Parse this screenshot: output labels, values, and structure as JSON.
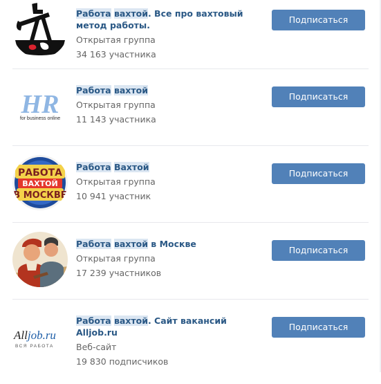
{
  "groups": [
    {
      "title_hl1": "Работа",
      "title_sp1": " ",
      "title_hl2": "вахтой",
      "title_rest": ". Все про вахтовый метод работы.",
      "type": "Открытая группа",
      "members": "34 163 участника",
      "button": "Подписаться",
      "avatar_icon": "oil-pump-icon"
    },
    {
      "title_hl1": "Работа",
      "title_sp1": " ",
      "title_hl2": "вахтой",
      "title_rest": "",
      "type": "Открытая группа",
      "members": "11 143 участника",
      "button": "Подписаться",
      "avatar_icon": "hr-logo-icon",
      "logo_main": "HR",
      "logo_sub": "for business online"
    },
    {
      "title_hl1": "Работа",
      "title_sp1": " ",
      "title_hl2": "Вахтой",
      "title_rest": "",
      "type": "Открытая группа",
      "members": "10 941 участник",
      "button": "Подписаться",
      "avatar_icon": "badge-logo-icon",
      "logo_line1": "РАБОТА",
      "logo_line2": "ВАХТОЙ",
      "logo_line3": "В МОСКВЕ"
    },
    {
      "title_hl1": "Работа",
      "title_sp1": " ",
      "title_hl2": "вахтой",
      "title_rest": " в Москве",
      "type": "Открытая группа",
      "members": "17 239 участников",
      "button": "Подписаться",
      "avatar_icon": "workers-poster-icon"
    },
    {
      "title_hl1": "Работа",
      "title_sp1": " ",
      "title_hl2": "вахтой",
      "title_rest": ". Сайт вакансий Alljob.ru",
      "type": "Веб-сайт",
      "members": "19 830 подписчиков",
      "button": "Подписаться",
      "avatar_icon": "alljob-logo-icon",
      "logo_a": "All",
      "logo_b": "job.ru",
      "logo_sub": "ВСЯ РАБОТА"
    }
  ],
  "colors": {
    "accent": "#5181b8",
    "link": "#2a5885",
    "highlight": "#dbe6f2"
  }
}
